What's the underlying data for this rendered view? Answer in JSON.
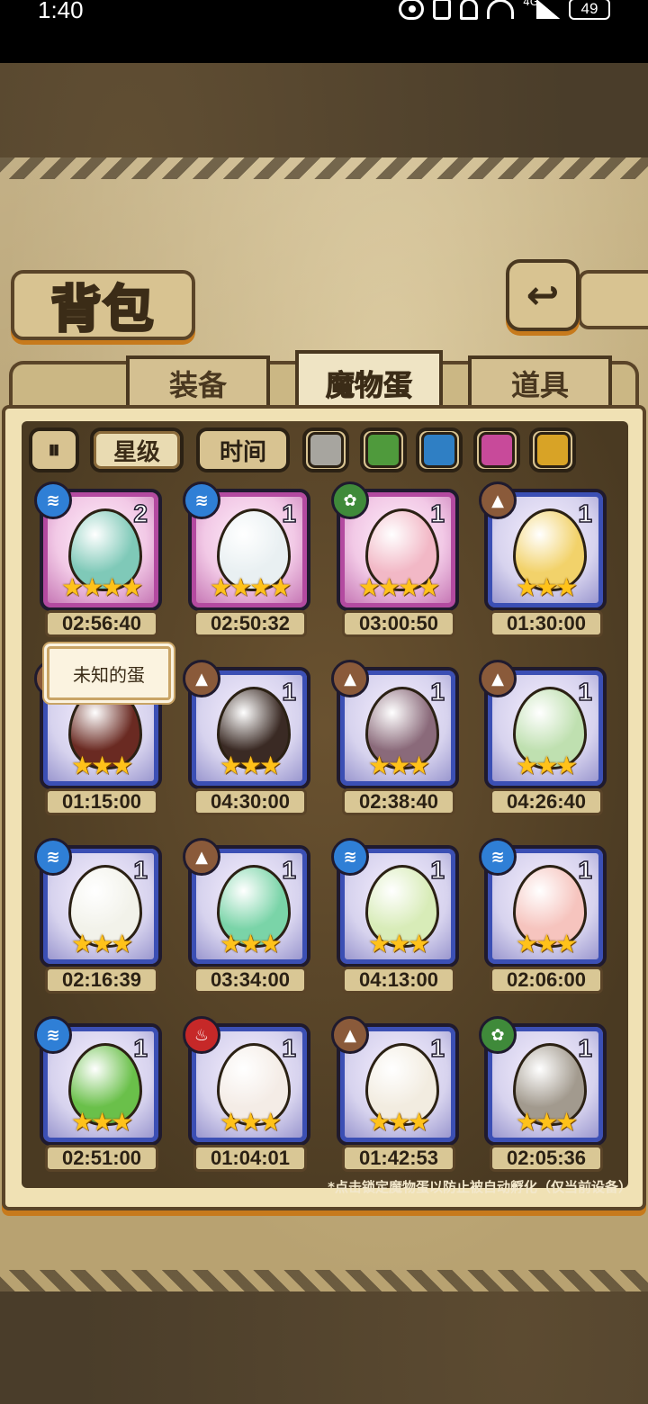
{
  "status_bar": {
    "time": "1:40",
    "network": "4G",
    "battery": "49"
  },
  "title": "背包",
  "tabs": [
    {
      "label": "装备",
      "active": false
    },
    {
      "label": "魔物蛋",
      "active": true
    },
    {
      "label": "道具",
      "active": false
    }
  ],
  "filters": {
    "sort_toggle_icon": "pause-icon",
    "star_label": "星级",
    "time_label": "时间",
    "color_swatches": [
      "#a7a59f",
      "#4f9a3c",
      "#2f7fc4",
      "#c84a9a",
      "#d8a326"
    ]
  },
  "tooltip": "未知的蛋",
  "eggs": [
    {
      "element": "water",
      "count": "2",
      "stars": "★★★★",
      "timer": "02:56:40",
      "frame": "purple",
      "color": "#7fc9b8"
    },
    {
      "element": "water",
      "count": "1",
      "stars": "★★★★",
      "timer": "02:50:32",
      "frame": "purple",
      "color": "#e9f0f2"
    },
    {
      "element": "grass",
      "count": "1",
      "stars": "★★★★",
      "timer": "03:00:50",
      "frame": "purple",
      "color": "#f2b8c6"
    },
    {
      "element": "earth",
      "count": "1",
      "stars": "★★★",
      "timer": "01:30:00",
      "frame": "blue",
      "color": "#f2d26a"
    },
    {
      "element": "earth",
      "count": "",
      "stars": "★★★",
      "timer": "01:15:00",
      "frame": "blue",
      "color": "#6a2a22"
    },
    {
      "element": "earth",
      "count": "1",
      "stars": "★★★",
      "timer": "04:30:00",
      "frame": "blue",
      "color": "#3a2a24"
    },
    {
      "element": "earth",
      "count": "1",
      "stars": "★★★",
      "timer": "02:38:40",
      "frame": "blue",
      "color": "#8a6a7a"
    },
    {
      "element": "earth",
      "count": "1",
      "stars": "★★★",
      "timer": "04:26:40",
      "frame": "blue",
      "color": "#bfe0b0"
    },
    {
      "element": "water",
      "count": "1",
      "stars": "★★★",
      "timer": "02:16:39",
      "frame": "blue",
      "color": "#f2f2ea"
    },
    {
      "element": "earth",
      "count": "1",
      "stars": "★★★",
      "timer": "03:34:00",
      "frame": "blue",
      "color": "#7ad4a8"
    },
    {
      "element": "water",
      "count": "1",
      "stars": "★★★",
      "timer": "04:13:00",
      "frame": "blue",
      "color": "#d8ecb8"
    },
    {
      "element": "water",
      "count": "1",
      "stars": "★★★",
      "timer": "02:06:00",
      "frame": "blue",
      "color": "#f6c4be"
    },
    {
      "element": "water",
      "count": "1",
      "stars": "★★★",
      "timer": "02:51:00",
      "frame": "blue",
      "color": "#6ac04a"
    },
    {
      "element": "fire",
      "count": "1",
      "stars": "★★★",
      "timer": "01:04:01",
      "frame": "blue",
      "color": "#f4ece6"
    },
    {
      "element": "earth",
      "count": "1",
      "stars": "★★★",
      "timer": "01:42:53",
      "frame": "blue",
      "color": "#f2ece0"
    },
    {
      "element": "grass",
      "count": "1",
      "stars": "★★★",
      "timer": "02:05:36",
      "frame": "blue",
      "color": "#a29a8e"
    }
  ],
  "footnote": "*点击锁定魔物蛋以防止被自动孵化（仅当前设备）"
}
